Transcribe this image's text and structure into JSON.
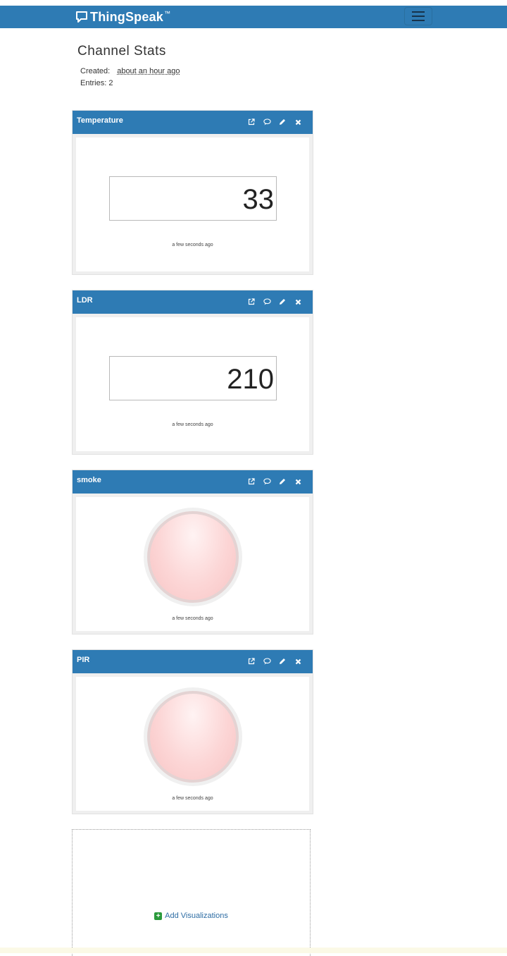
{
  "brand": {
    "name": "ThingSpeak",
    "tm": "™"
  },
  "page": {
    "title": "Channel Stats",
    "created_label": "Created:",
    "created_value": "about an hour ago",
    "entries_label": "Entries: 2"
  },
  "widgets": [
    {
      "title": "Temperature",
      "type": "numeric",
      "value": "33",
      "timestamp": "a few seconds ago"
    },
    {
      "title": "LDR",
      "type": "numeric",
      "value": "210",
      "timestamp": "a few seconds ago"
    },
    {
      "title": "smoke",
      "type": "lamp",
      "timestamp": "a few seconds ago",
      "lamp_color": "#f9cfcf"
    },
    {
      "title": "PIR",
      "type": "lamp",
      "timestamp": "a few seconds ago",
      "lamp_color": "#f9cfcf"
    }
  ],
  "add": {
    "label": "Add Visualizations",
    "icon": "plus-square-icon"
  },
  "colors": {
    "nav": "#2e7bb4",
    "link": "#2e6da4",
    "plus": "#2b9a3c"
  },
  "icons": [
    "external-link-icon",
    "comment-icon",
    "pencil-icon",
    "close-icon"
  ]
}
